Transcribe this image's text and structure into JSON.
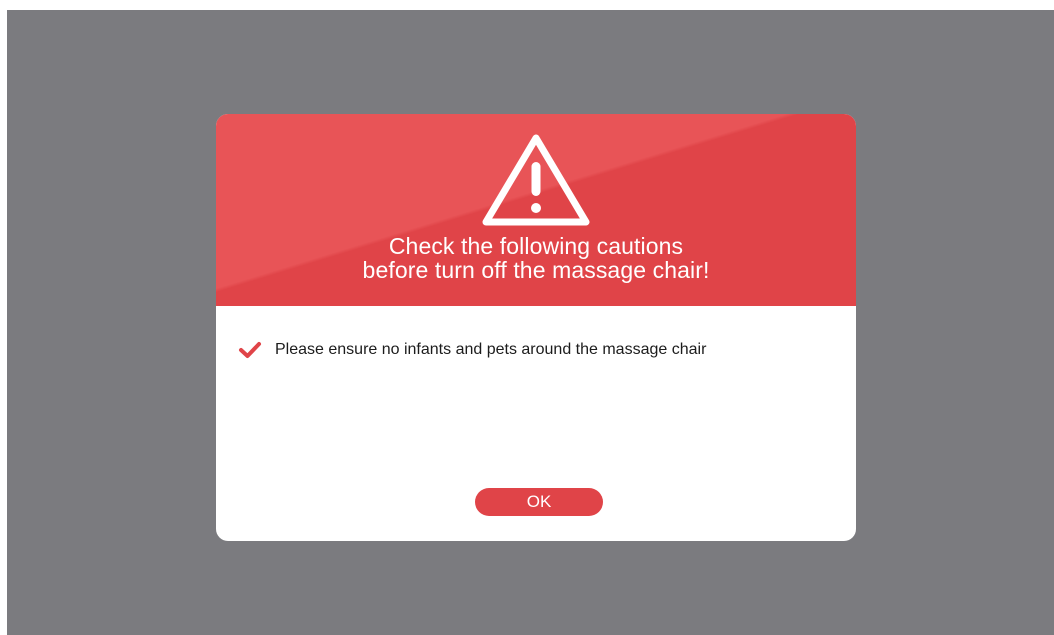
{
  "dialog": {
    "title_line1": "Check the following cautions",
    "title_line2": "before turn off the massage chair!",
    "icon": "warning-triangle-icon",
    "cautions": [
      "Please ensure no infants and pets around the massage chair"
    ],
    "ok_label": "OK"
  },
  "colors": {
    "backdrop": "#7b7b7f",
    "header_red": "#e85457",
    "accent_red": "#e04448",
    "dialog_bg": "#ffffff"
  }
}
